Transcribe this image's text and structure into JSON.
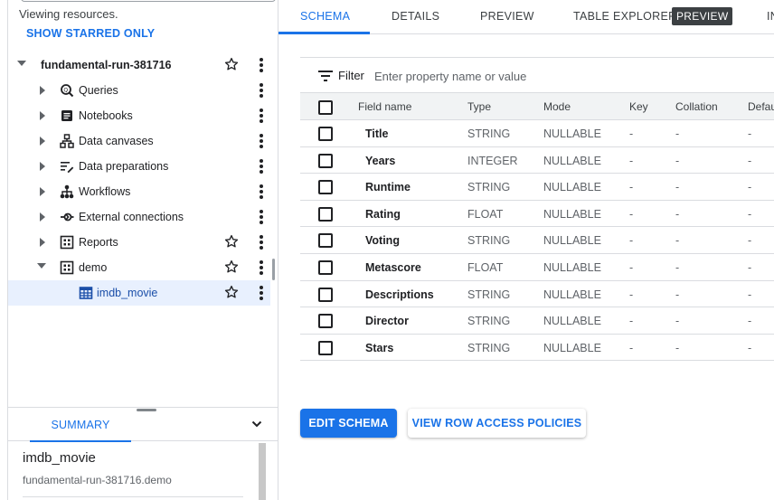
{
  "explorer": {
    "viewing_text": "Viewing resources.",
    "show_starred_label": "SHOW STARRED ONLY",
    "tree": [
      {
        "label": "fundamental-run-381716",
        "level": 0,
        "expanded": true,
        "icon": "none",
        "starred_button": true,
        "bold": true
      },
      {
        "label": "Queries",
        "level": 1,
        "expanded": false,
        "icon": "query-icon",
        "starred_button": false
      },
      {
        "label": "Notebooks",
        "level": 1,
        "expanded": false,
        "icon": "notebook-icon",
        "starred_button": false
      },
      {
        "label": "Data canvases",
        "level": 1,
        "expanded": false,
        "icon": "data-canvas-icon",
        "starred_button": false
      },
      {
        "label": "Data preparations",
        "level": 1,
        "expanded": false,
        "icon": "data-preparation-icon",
        "starred_button": false
      },
      {
        "label": "Workflows",
        "level": 1,
        "expanded": false,
        "icon": "workflow-icon",
        "starred_button": false
      },
      {
        "label": "External connections",
        "level": 1,
        "expanded": false,
        "icon": "external-connection-icon",
        "starred_button": false
      },
      {
        "label": "Reports",
        "level": 1,
        "expanded": false,
        "icon": "dataset-icon",
        "starred_button": true
      },
      {
        "label": "demo",
        "level": 1,
        "expanded": true,
        "icon": "dataset-icon",
        "starred_button": true
      },
      {
        "label": "imdb_movie",
        "level": 2,
        "expanded": null,
        "icon": "table-icon",
        "starred_button": true,
        "selected": true
      }
    ]
  },
  "summary": {
    "tab_label": "SUMMARY",
    "title": "imdb_movie",
    "subtitle": "fundamental-run-381716.demo"
  },
  "tabs": [
    {
      "label": "SCHEMA",
      "active": true
    },
    {
      "label": "DETAILS",
      "active": false
    },
    {
      "label": "PREVIEW",
      "active": false
    },
    {
      "label": "TABLE EXPLORER",
      "active": false,
      "badge": "PREVIEW"
    },
    {
      "label": "IN",
      "active": false
    }
  ],
  "filter": {
    "label": "Filter",
    "placeholder": "Enter property name or value"
  },
  "schema": {
    "columns": [
      "Field name",
      "Type",
      "Mode",
      "Key",
      "Collation",
      "Defau"
    ],
    "rows": [
      {
        "name": "Title",
        "type": "STRING",
        "mode": "NULLABLE",
        "key": "-",
        "collation": "-",
        "default": "-"
      },
      {
        "name": "Years",
        "type": "INTEGER",
        "mode": "NULLABLE",
        "key": "-",
        "collation": "-",
        "default": "-"
      },
      {
        "name": "Runtime",
        "type": "STRING",
        "mode": "NULLABLE",
        "key": "-",
        "collation": "-",
        "default": "-"
      },
      {
        "name": "Rating",
        "type": "FLOAT",
        "mode": "NULLABLE",
        "key": "-",
        "collation": "-",
        "default": "-"
      },
      {
        "name": "Voting",
        "type": "STRING",
        "mode": "NULLABLE",
        "key": "-",
        "collation": "-",
        "default": "-"
      },
      {
        "name": "Metascore",
        "type": "FLOAT",
        "mode": "NULLABLE",
        "key": "-",
        "collation": "-",
        "default": "-"
      },
      {
        "name": "Descriptions",
        "type": "STRING",
        "mode": "NULLABLE",
        "key": "-",
        "collation": "-",
        "default": "-"
      },
      {
        "name": "Director",
        "type": "STRING",
        "mode": "NULLABLE",
        "key": "-",
        "collation": "-",
        "default": "-"
      },
      {
        "name": "Stars",
        "type": "STRING",
        "mode": "NULLABLE",
        "key": "-",
        "collation": "-",
        "default": "-"
      }
    ]
  },
  "buttons": {
    "edit_schema": "EDIT SCHEMA",
    "view_row_access": "VIEW ROW ACCESS POLICIES"
  },
  "colors": {
    "accent": "#1a73e8",
    "selected_row": "#e8f0fe",
    "badge_bg": "#3c4043"
  }
}
